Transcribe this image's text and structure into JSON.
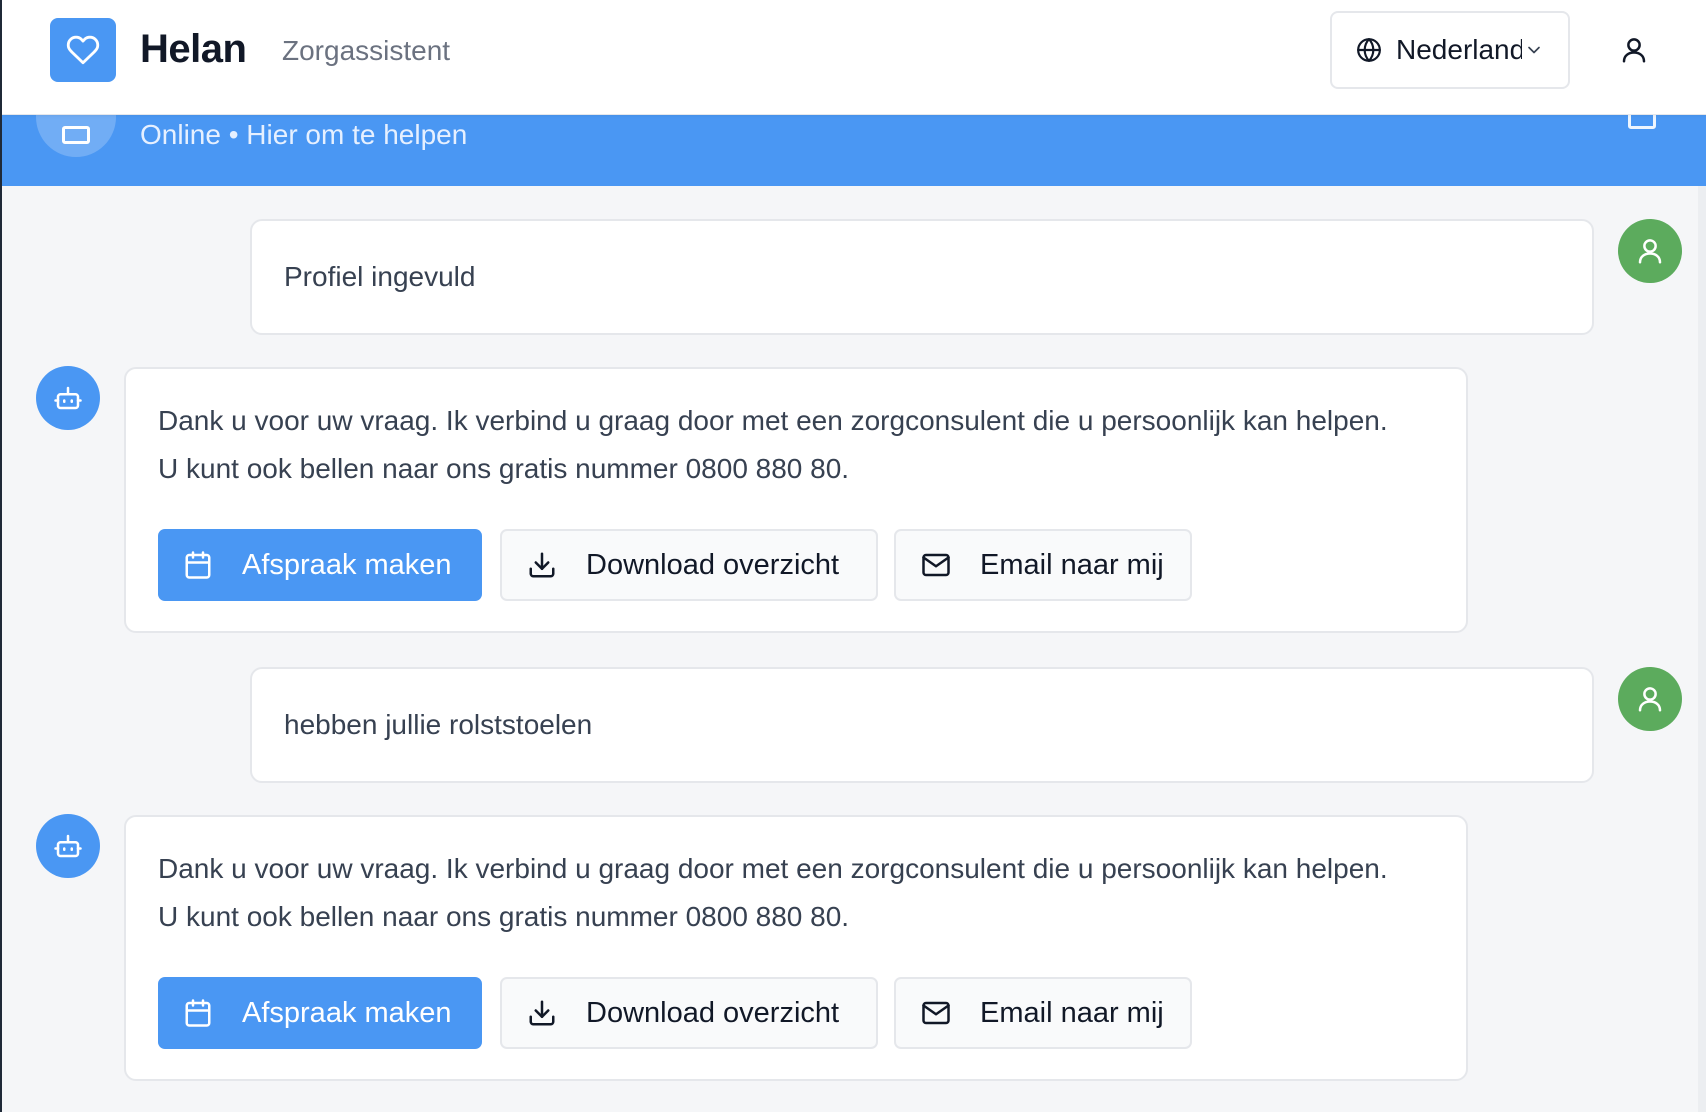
{
  "app": {
    "brand": "Helan",
    "subtitle": "Zorgassistent",
    "language": "Nederlands"
  },
  "chat_header": {
    "status": "Online • Hier om te helpen"
  },
  "messages": [
    {
      "role": "user",
      "text": "Profiel ingevuld"
    },
    {
      "role": "bot",
      "line1": "Dank u voor uw vraag. Ik verbind u graag door met een zorgconsulent die u persoonlijk kan helpen.",
      "line2": "U kunt ook bellen naar ons gratis nummer 0800 880 80.",
      "actions": {
        "appointment": "Afspraak maken",
        "download": "Download overzicht",
        "email": "Email naar mij"
      }
    },
    {
      "role": "user",
      "text": "hebben jullie rolststoelen"
    },
    {
      "role": "bot",
      "line1": "Dank u voor uw vraag. Ik verbind u graag door met een zorgconsulent die u persoonlijk kan helpen.",
      "line2": "U kunt ook bellen naar ons gratis nummer 0800 880 80.",
      "actions": {
        "appointment": "Afspraak maken",
        "download": "Download overzicht",
        "email": "Email naar mij"
      }
    }
  ],
  "icons": {
    "logo": "heart-icon",
    "language": "globe-icon",
    "profile": "user-icon",
    "bot": "robot-icon",
    "appointment": "calendar-icon",
    "download": "download-icon",
    "email": "mail-icon"
  },
  "colors": {
    "accent": "#4a97f3",
    "user_avatar": "#5cab5d",
    "background": "#f5f6f8"
  }
}
